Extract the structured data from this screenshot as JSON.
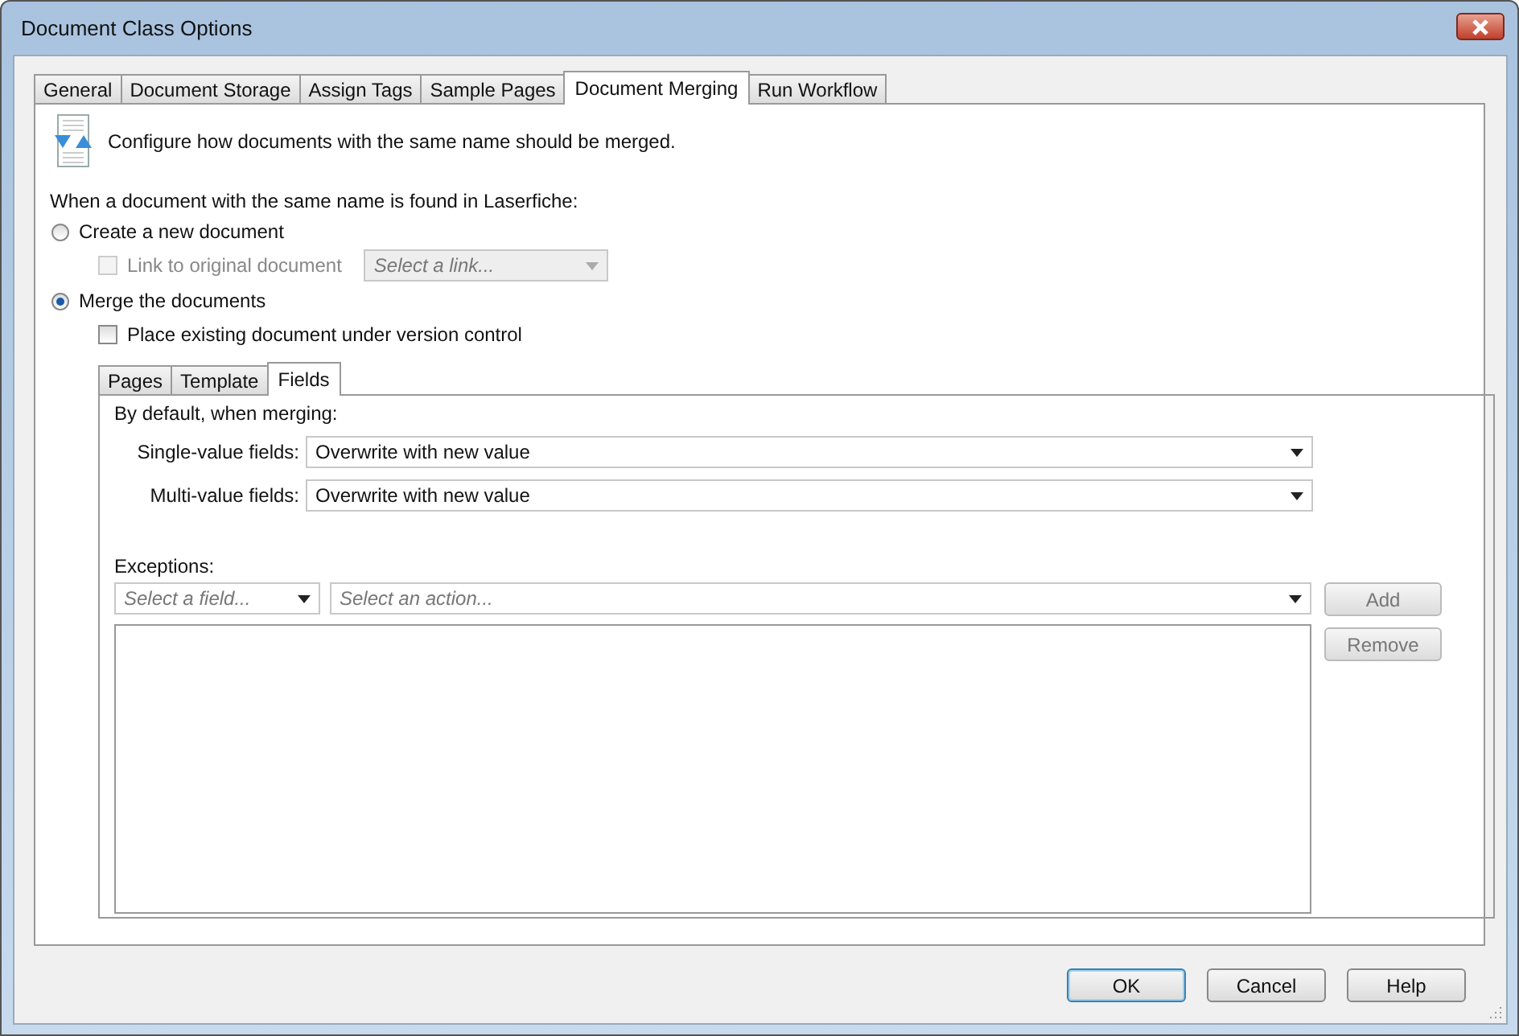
{
  "window": {
    "title": "Document Class Options"
  },
  "tabs": [
    {
      "label": "General",
      "selected": false
    },
    {
      "label": "Document Storage",
      "selected": false
    },
    {
      "label": "Assign Tags",
      "selected": false
    },
    {
      "label": "Sample Pages",
      "selected": false
    },
    {
      "label": "Document Merging",
      "selected": true
    },
    {
      "label": "Run Workflow",
      "selected": false
    }
  ],
  "description": "Configure how documents with the same name should be merged.",
  "prompt": "When a document with the same name is found in Laserfiche:",
  "options": [
    {
      "label": "Create a new document",
      "selected": false,
      "sub": {
        "kind": "link",
        "label": "Link to original document",
        "checked": false,
        "disabled": true,
        "placeholder": "Select a link..."
      }
    },
    {
      "label": "Merge the documents",
      "selected": true,
      "sub": {
        "kind": "check",
        "label": "Place existing document under version control",
        "checked": false,
        "disabled": false
      }
    }
  ],
  "merge_tabs": [
    {
      "label": "Pages",
      "selected": false
    },
    {
      "label": "Template",
      "selected": false
    },
    {
      "label": "Fields",
      "selected": true
    }
  ],
  "defaults_heading": "By default, when merging:",
  "defaults": [
    {
      "label": "Single-value fields:",
      "value": "Overwrite with new value"
    },
    {
      "label": "Multi-value fields:",
      "value": "Overwrite with new value"
    }
  ],
  "exceptions": {
    "label": "Exceptions:",
    "field_placeholder": "Select a field...",
    "action_placeholder": "Select an action...",
    "buttons": [
      {
        "label": "Add",
        "disabled": true
      },
      {
        "label": "Remove",
        "disabled": true
      }
    ]
  },
  "buttons": [
    {
      "label": "OK",
      "default": true
    },
    {
      "label": "Cancel",
      "default": false
    },
    {
      "label": "Help",
      "default": false
    }
  ]
}
